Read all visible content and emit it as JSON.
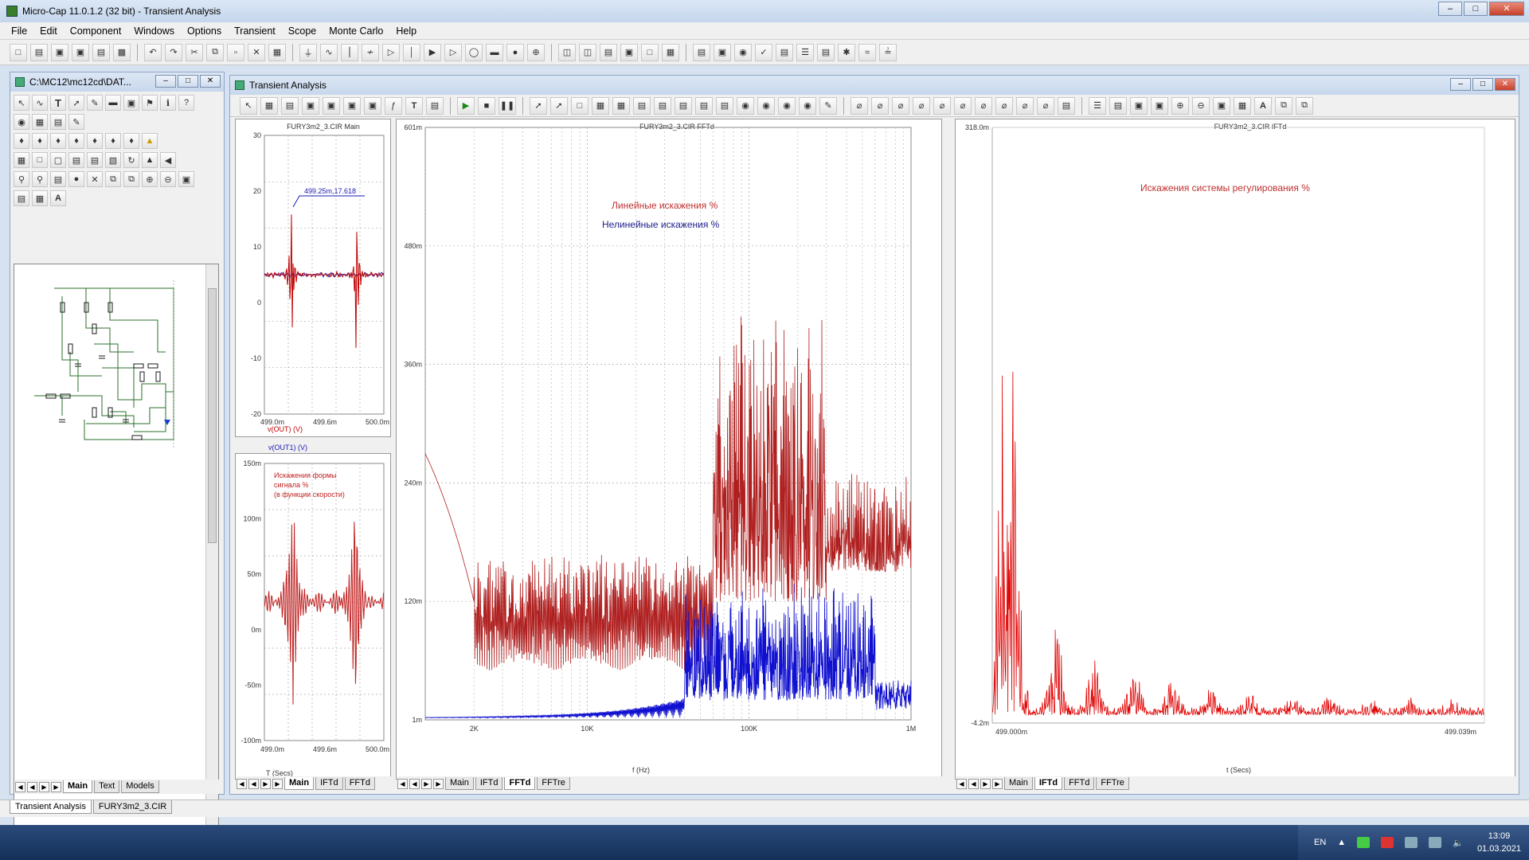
{
  "app": {
    "title": "Micro-Cap 11.0.1.2 (32 bit) - Transient Analysis"
  },
  "menu": [
    "File",
    "Edit",
    "Component",
    "Windows",
    "Options",
    "Transient",
    "Scope",
    "Monte Carlo",
    "Help"
  ],
  "schematic_window": {
    "title": "C:\\MC12\\mc12cd\\DAT...",
    "tabs": [
      "Main",
      "Text",
      "Models"
    ]
  },
  "analysis_window": {
    "title": "Transient Analysis"
  },
  "plots": {
    "p1": {
      "title": "FURY3m2_3.CIR Main",
      "y_ticks": [
        "30",
        "20",
        "10",
        "0",
        "-10",
        "-20"
      ],
      "x_ticks": [
        "499.0m",
        "499.6m",
        "500.0m"
      ],
      "cursor_label": "499.25m,17.618",
      "series_labels": [
        "v(OUT) (V)",
        "v(OUT1) (V)"
      ],
      "series_colors": [
        "#c00000",
        "#1a1ab4"
      ]
    },
    "p2": {
      "y_ticks": [
        "150m",
        "100m",
        "50m",
        "0m",
        "-50m",
        "-100m"
      ],
      "x_ticks": [
        "499.0m",
        "499.6m",
        "500.0m"
      ],
      "annotation": [
        "Искажения формы",
        "сигнала %",
        "(в функции скорости)"
      ],
      "xlabel": "T (Secs)",
      "tabs": [
        "Main",
        "IFTd",
        "FFTd"
      ]
    },
    "p3": {
      "title": "FURY3m2_3.CIR FFTd",
      "y_ticks": [
        "601m",
        "480m",
        "360m",
        "240m",
        "120m",
        "1m"
      ],
      "x_ticks": [
        "2K",
        "10K",
        "100K",
        "1M"
      ],
      "xlabel": "f (Hz)",
      "legend": [
        "Линейные искажения  %",
        "Нелинейные искажения %"
      ],
      "tabs": [
        "Main",
        "IFTd",
        "FFTd",
        "FFTre"
      ]
    },
    "p4": {
      "title": "FURY3m2_3.CIR IFTd",
      "y_ticks": [
        "318.0m",
        "-4.2m"
      ],
      "x_ticks": [
        "499.000m",
        "499.039m"
      ],
      "xlabel": "t (Secs)",
      "annotation": "Искажения системы регулирования %",
      "tabs": [
        "Main",
        "IFTd",
        "FFTd",
        "FFTre"
      ]
    }
  },
  "statusbar_tabs": [
    "Transient Analysis",
    "FURY3m2_3.CIR"
  ],
  "tray": {
    "lang": "EN",
    "time": "13:09",
    "date": "01.03.2021"
  },
  "colors": {
    "red": "#e00000",
    "darkred": "#b03030",
    "blue": "#1010d0"
  }
}
